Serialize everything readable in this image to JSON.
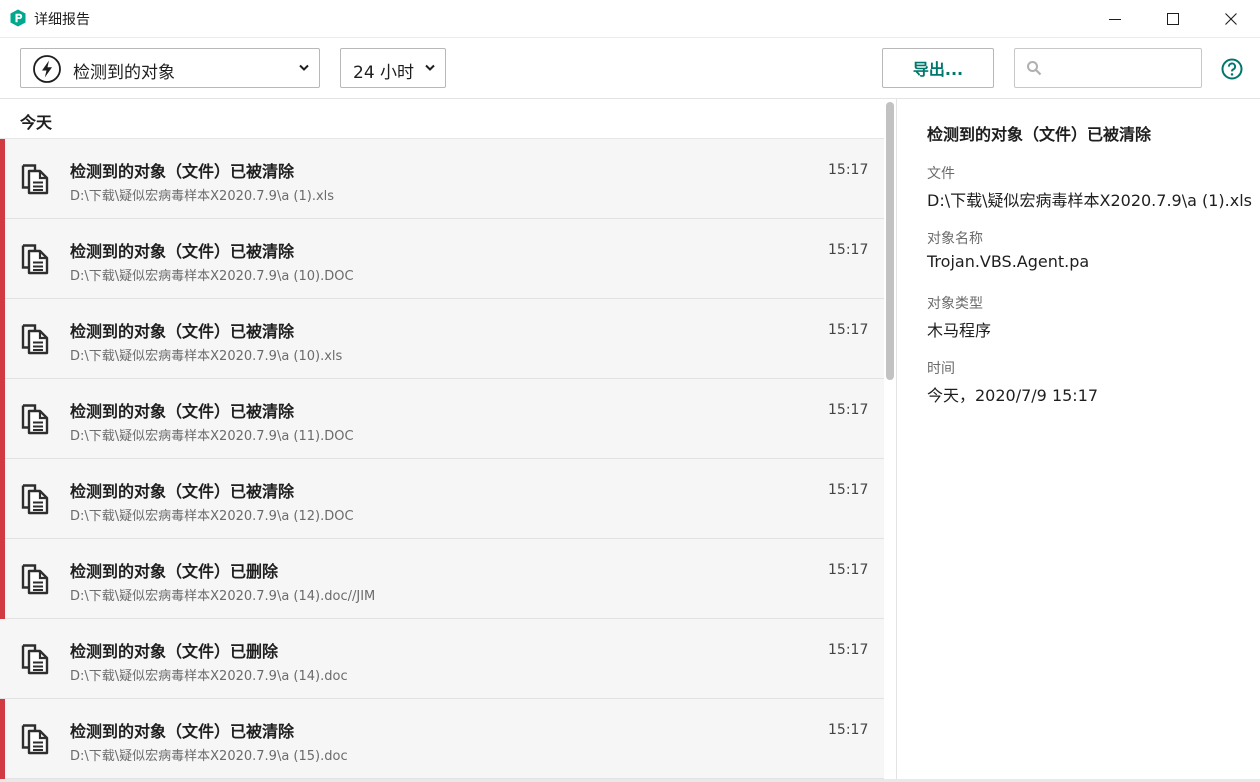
{
  "window": {
    "title": "详细报告"
  },
  "toolbar": {
    "type_filter": "检测到的对象",
    "period_filter": "24 小时",
    "export_label": "导出...",
    "search_placeholder": ""
  },
  "list": {
    "group": "今天",
    "rows": [
      {
        "title": "检测到的对象（文件）已被清除",
        "path": "D:\\下载\\疑似宏病毒样本X2020.7.9\\a (1).xls",
        "time": "15:17",
        "marked": true
      },
      {
        "title": "检测到的对象（文件）已被清除",
        "path": "D:\\下载\\疑似宏病毒样本X2020.7.9\\a (10).DOC",
        "time": "15:17",
        "marked": true
      },
      {
        "title": "检测到的对象（文件）已被清除",
        "path": "D:\\下载\\疑似宏病毒样本X2020.7.9\\a (10).xls",
        "time": "15:17",
        "marked": true
      },
      {
        "title": "检测到的对象（文件）已被清除",
        "path": "D:\\下载\\疑似宏病毒样本X2020.7.9\\a (11).DOC",
        "time": "15:17",
        "marked": true
      },
      {
        "title": "检测到的对象（文件）已被清除",
        "path": "D:\\下载\\疑似宏病毒样本X2020.7.9\\a (12).DOC",
        "time": "15:17",
        "marked": true
      },
      {
        "title": "检测到的对象（文件）已删除",
        "path": "D:\\下载\\疑似宏病毒样本X2020.7.9\\a (14).doc//JIM",
        "time": "15:17",
        "marked": true
      },
      {
        "title": "检测到的对象（文件）已删除",
        "path": "D:\\下载\\疑似宏病毒样本X2020.7.9\\a (14).doc",
        "time": "15:17",
        "marked": false
      },
      {
        "title": "检测到的对象（文件）已被清除",
        "path": "D:\\下载\\疑似宏病毒样本X2020.7.9\\a (15).doc",
        "time": "15:17",
        "marked": true
      }
    ]
  },
  "details": {
    "title": "检测到的对象（文件）已被清除",
    "fields": [
      {
        "label": "文件",
        "value": "D:\\下载\\疑似宏病毒样本X2020.7.9\\a (1).xls"
      },
      {
        "label": "对象名称",
        "value": "Trojan.VBS.Agent.pa"
      },
      {
        "label": "对象类型",
        "value": "木马程序"
      },
      {
        "label": "时间",
        "value": "今天，2020/7/9 15:17"
      }
    ]
  },
  "colors": {
    "accent": "#00776c",
    "marker": "#d13a42",
    "logo": "#00a88e"
  },
  "icons": {
    "logo": "app-logo-icon",
    "minimize": "minimize-icon",
    "maximize": "maximize-icon",
    "close": "close-icon",
    "type": "lightning-bolt-icon",
    "caret": "chevron-down-icon",
    "search": "search-icon",
    "help": "help-icon",
    "row": "document-copy-icon"
  }
}
